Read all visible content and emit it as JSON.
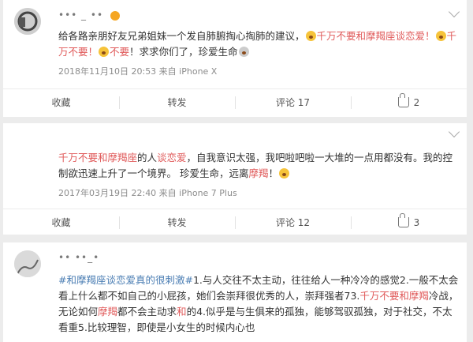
{
  "posts": [
    {
      "username": "••• _ ••",
      "text_segments": [
        {
          "text": "给各路亲朋好友兄弟姐妹一个发自肺腑掏心掏肺的建议，",
          "style": "normal"
        },
        {
          "text": "千万不要和摩羯座谈恋爱！",
          "style": "hl"
        },
        {
          "text": "千万不要！",
          "style": "hl"
        },
        {
          "text": "不要",
          "style": "hl"
        },
        {
          "text": "！求求你们了，珍爱生命",
          "style": "normal"
        }
      ],
      "meta": "2018年11月10日 20:53  来自 iPhone X",
      "actions": {
        "favorite": "收藏",
        "repost": "转发",
        "comment": "评论 17",
        "like": "2"
      }
    },
    {
      "text_segments": [
        {
          "text": "千万不要和摩羯座",
          "style": "hl"
        },
        {
          "text": "的人",
          "style": "normal"
        },
        {
          "text": "谈恋爱",
          "style": "hl"
        },
        {
          "text": "，自我意识太强，我吧啦吧啦一大堆的一点用都没有。我的控制欲迅速上升了一个境界。 珍爱生命，远离",
          "style": "normal"
        },
        {
          "text": "摩羯",
          "style": "hl"
        },
        {
          "text": "！",
          "style": "normal"
        }
      ],
      "meta": "2017年03月19日 22:40  来自 iPhone 7 Plus",
      "actions": {
        "favorite": "收藏",
        "repost": "转发",
        "comment": "评论 12",
        "like": "3"
      }
    },
    {
      "username": "•• ••_•",
      "text_segments": [
        {
          "text": "#和摩羯座谈恋爱真的很刺激#",
          "style": "tag"
        },
        {
          "text": "1.与人交往不太主动，往往给人一种冷冷的感觉2.一般不太会看上什么都不如自己的小屁孩，她们会崇拜很优秀的人，崇拜强者73.",
          "style": "normal"
        },
        {
          "text": "千万不要和摩羯",
          "style": "hl"
        },
        {
          "text": "冷战，无论如何",
          "style": "normal"
        },
        {
          "text": "摩羯",
          "style": "hl"
        },
        {
          "text": "都不会主动求",
          "style": "normal"
        },
        {
          "text": "和",
          "style": "hl"
        },
        {
          "text": "的4.似乎是与生俱来的孤独，能够驾驭孤独，对于社交，不太看重5.比较理智，即使是小女生的时候内心也",
          "style": "normal"
        }
      ]
    }
  ]
}
